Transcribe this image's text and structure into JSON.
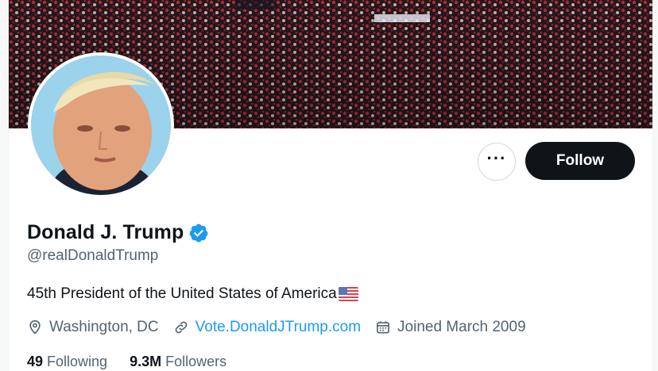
{
  "profile": {
    "name": "Donald J. Trump",
    "handle": "@realDonaldTrump",
    "bio": "45th President of the United States of America",
    "location": "Washington, DC",
    "website": "Vote.DonaldJTrump.com",
    "joined": "Joined March 2009",
    "following_count": "49",
    "following_label": "Following",
    "followers_count": "9.3M",
    "followers_label": "Followers"
  },
  "actions": {
    "follow_label": "Follow",
    "more_label": "···"
  },
  "icons": {
    "verified": "verified-badge-icon",
    "location": "map-pin-icon",
    "link": "link-icon",
    "calendar": "calendar-icon",
    "flag": "us-flag-icon"
  },
  "colors": {
    "accent": "#1d9bf0",
    "text": "#0f1419",
    "secondary": "#536471",
    "follow_bg": "#0f1419"
  }
}
